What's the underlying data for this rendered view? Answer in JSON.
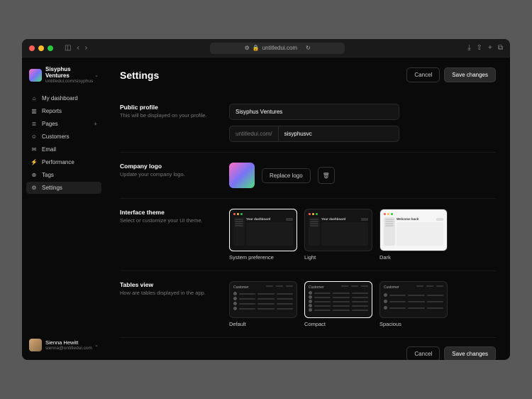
{
  "browser": {
    "url": "untitledui.com"
  },
  "org": {
    "name": "Sisyphus Ventures",
    "url": "untitledui.com/sisyphus"
  },
  "nav": {
    "items": [
      {
        "label": "My dashboard",
        "icon": "home"
      },
      {
        "label": "Reports",
        "icon": "bar"
      },
      {
        "label": "Pages",
        "icon": "layers",
        "plus": true
      },
      {
        "label": "Customers",
        "icon": "users"
      },
      {
        "label": "Email",
        "icon": "mail"
      },
      {
        "label": "Performance",
        "icon": "zap"
      },
      {
        "label": "Tags",
        "icon": "tag"
      },
      {
        "label": "Settings",
        "icon": "gear",
        "active": true
      }
    ]
  },
  "user": {
    "name": "Sienna Hewitt",
    "email": "sienna@untitledui.com"
  },
  "page": {
    "title": "Settings",
    "cancel": "Cancel",
    "save": "Save changes"
  },
  "profile": {
    "title": "Public profile",
    "desc": "This will be displayed on your profile.",
    "name_value": "Sisyphus Ventures",
    "url_prefix": "untitledui.com/",
    "url_value": "sisyphusvc"
  },
  "logo": {
    "title": "Company logo",
    "desc": "Update your company logo.",
    "replace": "Replace logo"
  },
  "theme": {
    "title": "Interface theme",
    "desc": "Select or customize your UI theme.",
    "mini_label": "Your dashboard",
    "light_label": "Welcome back",
    "opts": [
      "System preference",
      "Light",
      "Dark"
    ]
  },
  "tables": {
    "title": "Tables view",
    "desc": "How are tables displayed in the app.",
    "col_label": "Customer",
    "opts": [
      "Default",
      "Compact",
      "Spacious"
    ]
  }
}
